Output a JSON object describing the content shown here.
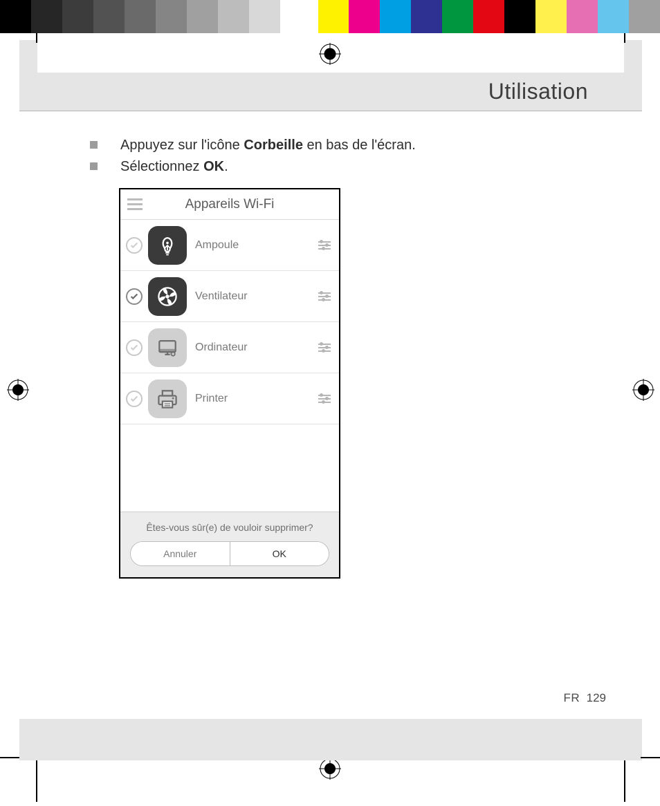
{
  "colorbar": [
    "#000000",
    "#262626",
    "#3c3c3c",
    "#525252",
    "#6a6a6a",
    "#858585",
    "#a0a0a0",
    "#bcbcbc",
    "#d8d8d8",
    "#ffffff",
    "#ffffff",
    "#fff200",
    "#ec008c",
    "#009fe3",
    "#2e3192",
    "#009640",
    "#e30613",
    "#000000",
    "#fff04d",
    "#e66eb2",
    "#66c5ed",
    "#a0a0a0"
  ],
  "heading": "Utilisation",
  "bullets": [
    {
      "pre": "Appuyez sur l'icône ",
      "bold": "Corbeille",
      "post": " en bas de l'écran."
    },
    {
      "pre": "Sélectionnez ",
      "bold": "OK",
      "post": "."
    }
  ],
  "phone": {
    "header": "Appareils Wi-Fi",
    "devices": [
      {
        "label": "Ampoule",
        "icon": "bulb",
        "selected": false,
        "bg": "#3a3a3a",
        "fg": "#ffffff"
      },
      {
        "label": "Ventilateur",
        "icon": "fan",
        "selected": true,
        "bg": "#3a3a3a",
        "fg": "#ffffff"
      },
      {
        "label": "Ordinateur",
        "icon": "monitor",
        "selected": false,
        "bg": "#d0d0d0",
        "fg": "#6e6e6e"
      },
      {
        "label": "Printer",
        "icon": "printer",
        "selected": false,
        "bg": "#d0d0d0",
        "fg": "#6e6e6e"
      }
    ],
    "confirm": {
      "text": "Êtes-vous sûr(e) de vouloir supprimer?",
      "cancel": "Annuler",
      "ok": "OK"
    }
  },
  "footer": {
    "lang": "FR",
    "page": "129"
  }
}
